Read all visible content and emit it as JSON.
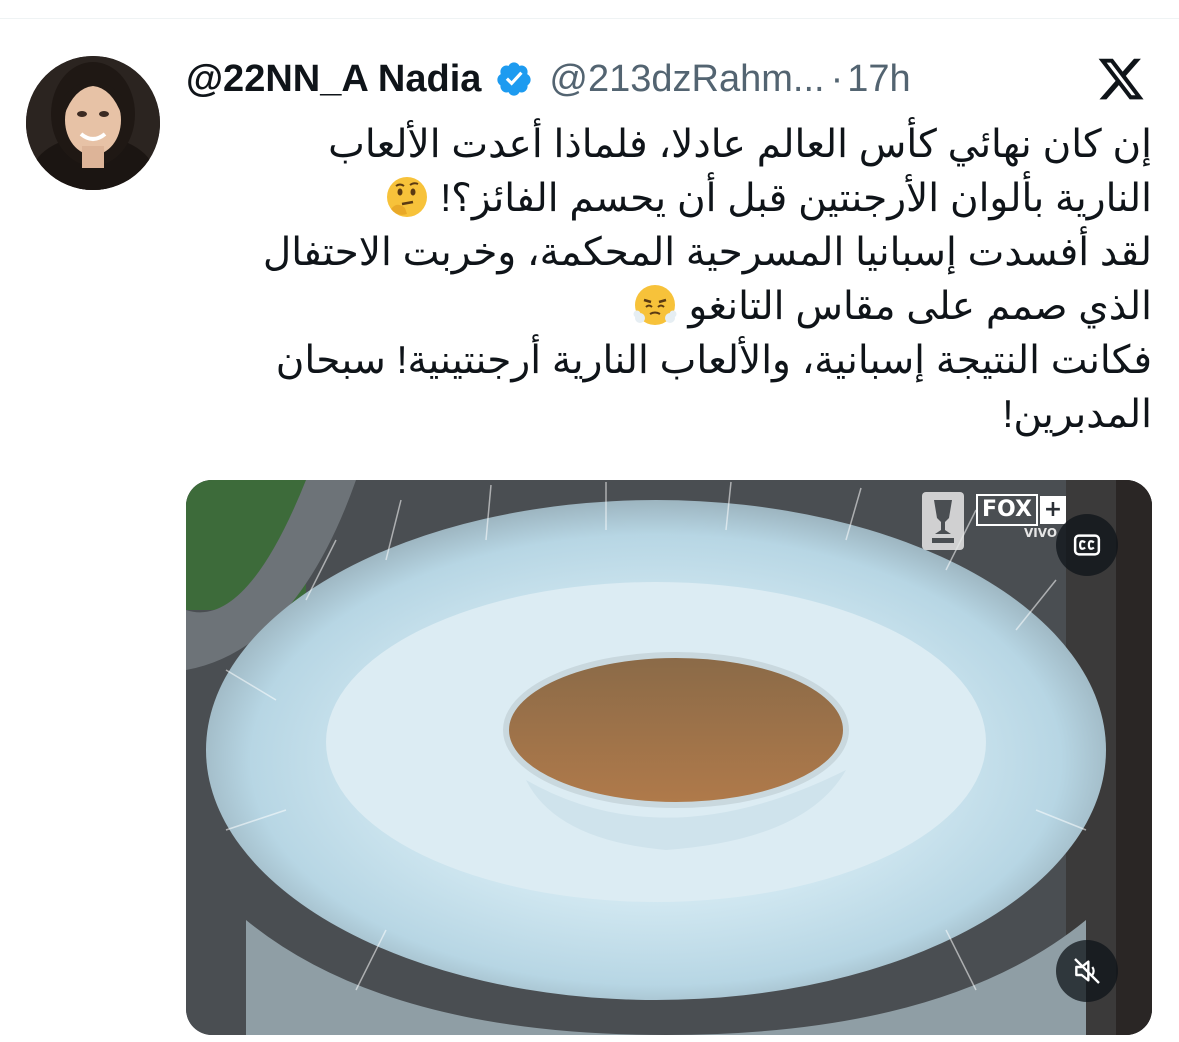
{
  "tweet": {
    "display_name": "@22NN_A Nadia",
    "handle": "@213dzRahm...",
    "separator": "·",
    "time": "17h",
    "verified": true,
    "lines": [
      "إن كان نهائي كأس العالم عادلا، فلماذا أعدت الألعاب",
      "النارية بألوان الأرجنتين قبل أن يحسم الفائز؟!",
      "لقد أفسدت إسبانيا المسرحية المحكمة، وخربت الاحتفال",
      "الذي صمم على مقاس التانغو",
      "فكانت النتيجة إسبانية، والألعاب النارية أرجنتينية! سبحان",
      "المدبرين!"
    ],
    "emojis": [
      "thinking-face-emoji",
      "face-with-steam-emoji"
    ]
  },
  "media": {
    "type": "video",
    "broadcast_logo": "FOX",
    "broadcast_plus": "+",
    "broadcast_sub": "VIVO",
    "controls": [
      "closed-captions-icon",
      "muted-speaker-icon"
    ]
  },
  "icons": {
    "platform": "x-logo-icon",
    "verified": "verified-badge-icon"
  },
  "colors": {
    "verified_blue": "#1d9bf0",
    "text_primary": "#0f1419",
    "text_secondary": "#536471"
  }
}
